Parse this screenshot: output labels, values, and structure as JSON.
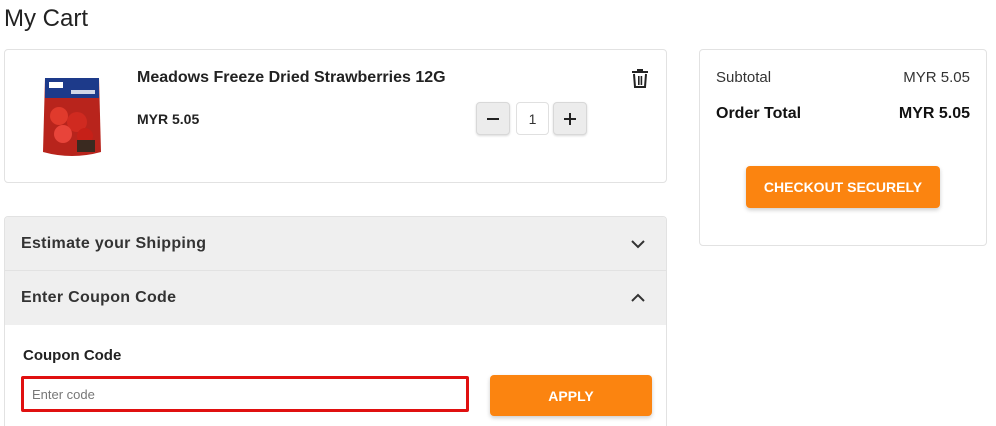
{
  "page": {
    "title": "My Cart"
  },
  "cart": {
    "items": [
      {
        "name": "Meadows Freeze Dried Strawberries 12G",
        "price": "MYR 5.05",
        "quantity": "1",
        "image_icon": "product-package-image"
      }
    ]
  },
  "summary": {
    "subtotal_label": "Subtotal",
    "subtotal_value": "MYR 5.05",
    "total_label": "Order Total",
    "total_value": "MYR 5.05",
    "checkout_label": "CHECKOUT SECURELY"
  },
  "shipping": {
    "title": "Estimate your Shipping",
    "expanded": false
  },
  "coupon": {
    "title": "Enter Coupon Code",
    "expanded": true,
    "field_label": "Coupon Code",
    "placeholder": "Enter code",
    "value": "",
    "apply_label": "APPLY"
  },
  "colors": {
    "accent": "#fb8410",
    "error_border": "#e01010",
    "panel_bg": "#efefef"
  }
}
